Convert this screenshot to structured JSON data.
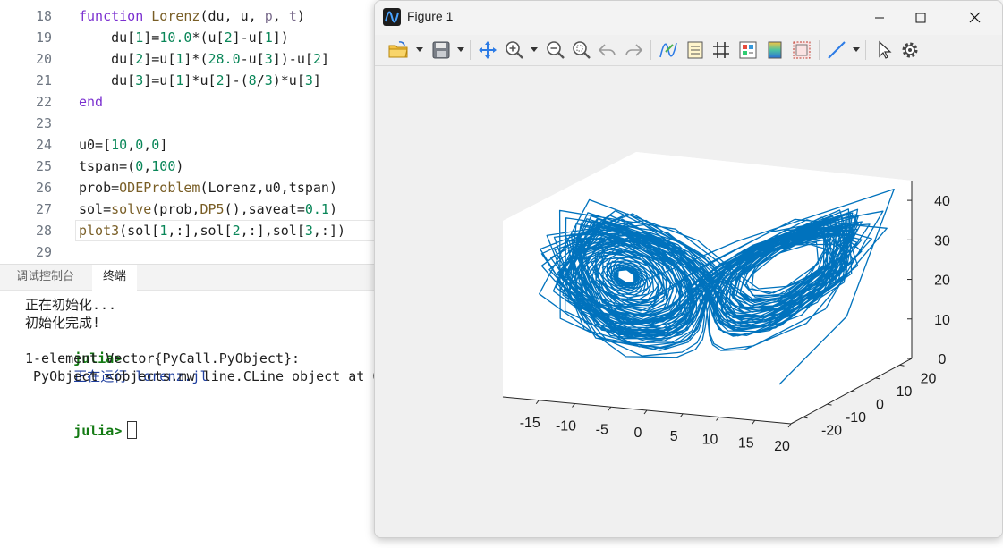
{
  "editor": {
    "lines": [
      {
        "num": "18",
        "tokens": [
          [
            "kw",
            "function "
          ],
          [
            "cl",
            "Lorenz"
          ],
          [
            "",
            "(du, u, "
          ],
          [
            "var",
            "p"
          ],
          [
            "",
            ", "
          ],
          [
            "var",
            "t"
          ],
          [
            "",
            ")"
          ]
        ]
      },
      {
        "num": "19",
        "tokens": [
          [
            "",
            "    du["
          ],
          [
            "num",
            "1"
          ],
          [
            "",
            "]="
          ],
          [
            "num",
            "10.0"
          ],
          [
            "",
            "*(u["
          ],
          [
            "num",
            "2"
          ],
          [
            "",
            "]-u["
          ],
          [
            "num",
            "1"
          ],
          [
            "",
            "])"
          ]
        ]
      },
      {
        "num": "20",
        "tokens": [
          [
            "",
            "    du["
          ],
          [
            "num",
            "2"
          ],
          [
            "",
            "]=u["
          ],
          [
            "num",
            "1"
          ],
          [
            "",
            "]*("
          ],
          [
            "num",
            "28.0"
          ],
          [
            "",
            "-u["
          ],
          [
            "num",
            "3"
          ],
          [
            "",
            "])-u["
          ],
          [
            "num",
            "2"
          ],
          [
            "",
            "]"
          ]
        ]
      },
      {
        "num": "21",
        "tokens": [
          [
            "",
            "    du["
          ],
          [
            "num",
            "3"
          ],
          [
            "",
            "]=u["
          ],
          [
            "num",
            "1"
          ],
          [
            "",
            "]*u["
          ],
          [
            "num",
            "2"
          ],
          [
            "",
            "]-("
          ],
          [
            "num",
            "8"
          ],
          [
            "",
            "/"
          ],
          [
            "num",
            "3"
          ],
          [
            "",
            ")*u["
          ],
          [
            "num",
            "3"
          ],
          [
            "",
            "]"
          ]
        ]
      },
      {
        "num": "22",
        "tokens": [
          [
            "kw",
            "end"
          ]
        ]
      },
      {
        "num": "23",
        "tokens": []
      },
      {
        "num": "24",
        "tokens": [
          [
            "",
            "u0=["
          ],
          [
            "num",
            "10"
          ],
          [
            "",
            ","
          ],
          [
            "num",
            "0"
          ],
          [
            "",
            ","
          ],
          [
            "num",
            "0"
          ],
          [
            "",
            "]"
          ]
        ]
      },
      {
        "num": "25",
        "tokens": [
          [
            "",
            "tspan=("
          ],
          [
            "num",
            "0"
          ],
          [
            "",
            ","
          ],
          [
            "num",
            "100"
          ],
          [
            "",
            ")"
          ]
        ]
      },
      {
        "num": "26",
        "tokens": [
          [
            "",
            "prob="
          ],
          [
            "cl",
            "ODEProblem"
          ],
          [
            "",
            "(Lorenz,u0,tspan)"
          ]
        ]
      },
      {
        "num": "27",
        "tokens": [
          [
            "",
            "sol="
          ],
          [
            "cl",
            "solve"
          ],
          [
            "",
            "(prob,"
          ],
          [
            "cl",
            "DP5"
          ],
          [
            "",
            "(),saveat="
          ],
          [
            "num",
            "0.1"
          ],
          [
            "",
            ")"
          ]
        ]
      },
      {
        "num": "28",
        "tokens": [
          [
            "cl",
            "plot3"
          ],
          [
            "",
            "(sol["
          ],
          [
            "num",
            "1"
          ],
          [
            "",
            ",:],sol["
          ],
          [
            "num",
            "2"
          ],
          [
            "",
            ",:],sol["
          ],
          [
            "num",
            "3"
          ],
          [
            "",
            ",:])"
          ]
        ]
      },
      {
        "num": "29",
        "tokens": []
      }
    ]
  },
  "panel": {
    "tabs": [
      {
        "label": "调试控制台",
        "active": false
      },
      {
        "label": "终端",
        "active": true
      }
    ],
    "terminal": {
      "line1": "正在初始化...",
      "line2": "初始化完成!",
      "prompt": "julia>",
      "run_text": "正在运行 lorenz.jl",
      "line4": "1-element Vector{PyCall.PyObject}:",
      "line5": " PyObject <objects.mw_line.CLine object at 0",
      "prompt2": "julia>"
    }
  },
  "figure": {
    "title": "Figure 1",
    "icons": {
      "app": "figure-app-icon",
      "open": "folder-open-icon",
      "save": "save-icon",
      "pan": "pan-move-icon",
      "zoom_in": "zoom-in-icon",
      "zoom_out": "zoom-out-icon",
      "zoom_fit": "zoom-fit-icon",
      "undo": "undo-icon",
      "redo": "redo-icon",
      "data_cursor": "data-cursor-icon",
      "legend": "legend-icon",
      "grid": "grid-icon",
      "colorbar": "colorbar-icon",
      "colormap": "colormap-icon",
      "box": "axes-box-icon",
      "line_style": "line-style-icon",
      "select": "select-pointer-icon",
      "settings": "settings-gear-icon"
    },
    "colors": {
      "line": "#0072bd"
    }
  },
  "chart_data": {
    "type": "line",
    "projection": "3d",
    "series": [
      {
        "system": "lorenz",
        "x0": [
          10,
          0,
          0
        ],
        "t_range": [
          0,
          100
        ],
        "dt": 0.1
      }
    ],
    "x_ticks": [
      "-15",
      "-10",
      "-5",
      "0",
      "5",
      "10",
      "15",
      "20"
    ],
    "y_ticks": [
      "-20",
      "-10",
      "0",
      "10",
      "20"
    ],
    "z_ticks": [
      "0",
      "10",
      "20",
      "30",
      "40"
    ],
    "xlim": [
      -20,
      20
    ],
    "ylim": [
      -25,
      25
    ],
    "zlim": [
      0,
      45
    ]
  }
}
